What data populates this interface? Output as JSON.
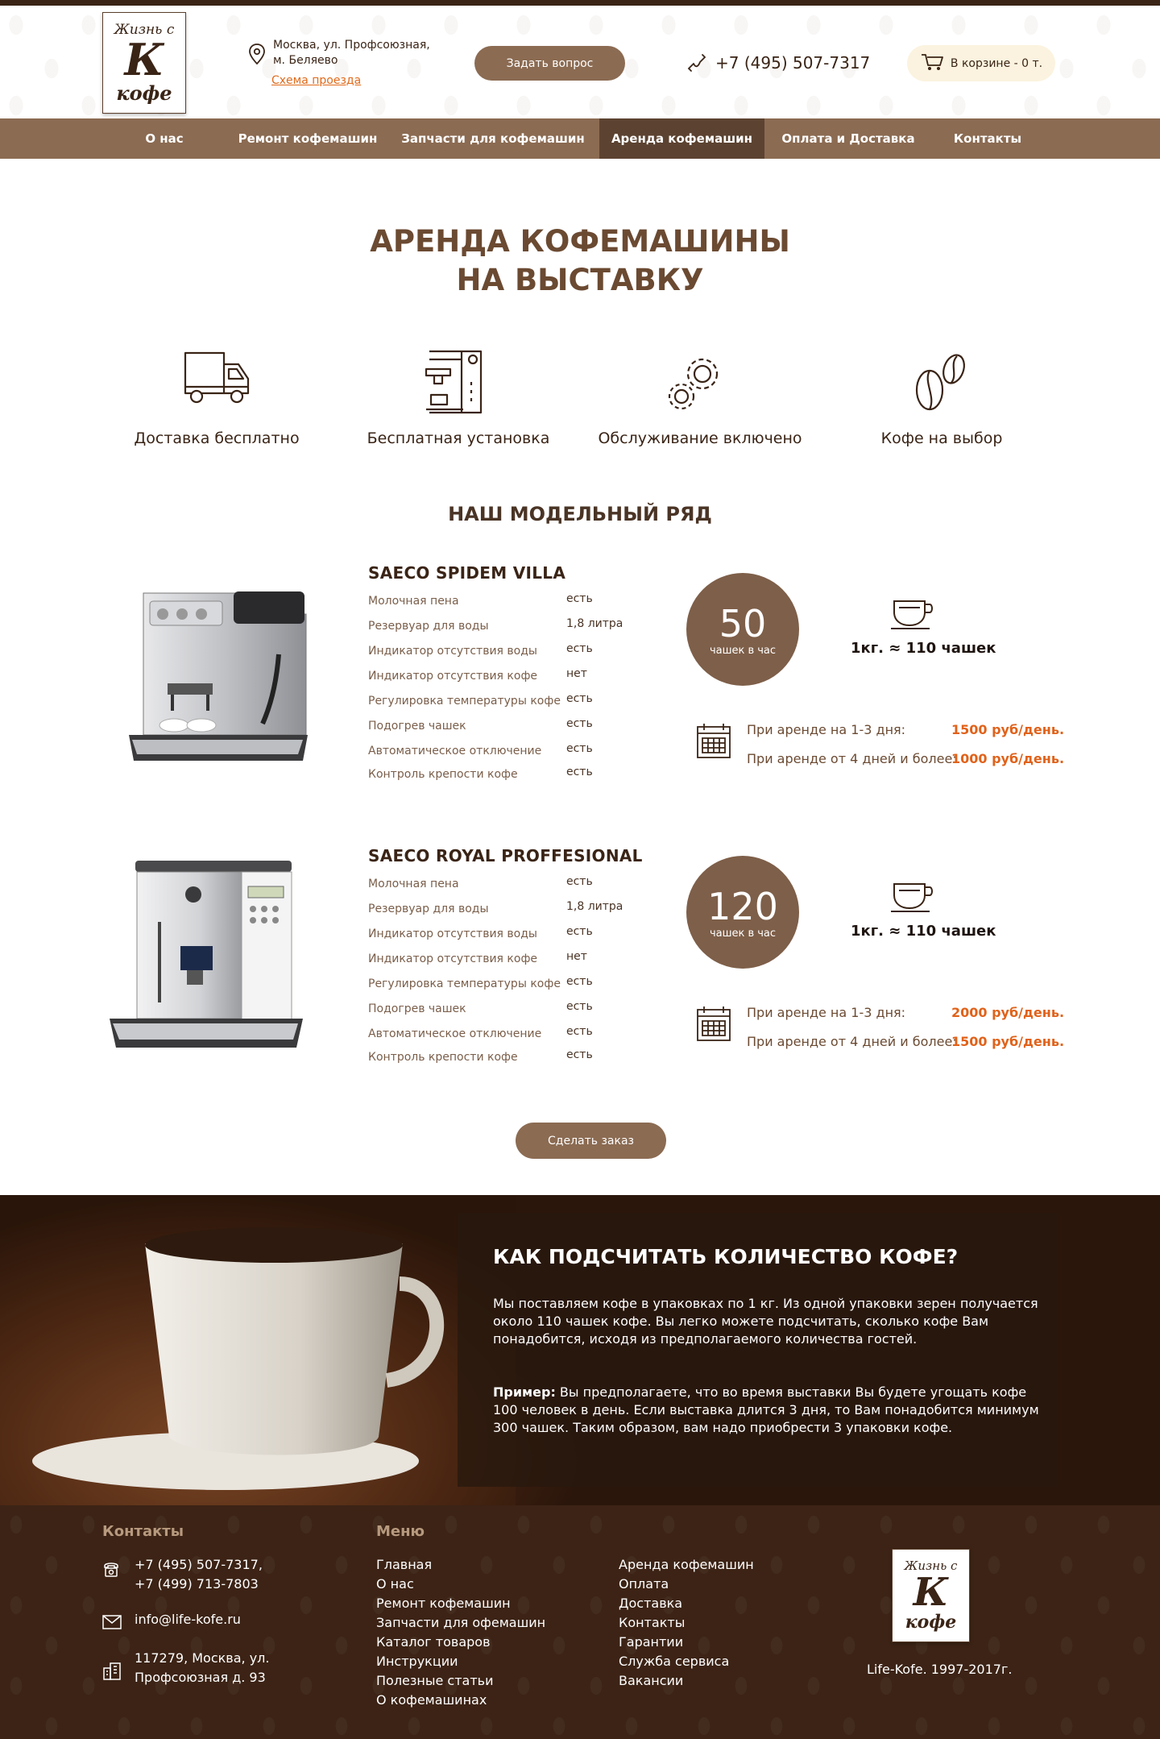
{
  "header": {
    "logo": {
      "line1": "Жизнь с",
      "big": "К",
      "line2": "кофе"
    },
    "address_line1": "Москва, ул. Профсоюзная,",
    "address_line2": "м. Беляево",
    "map_link": "Схема проезда",
    "ask_button": "Задать вопрос",
    "phone": "+7 (495) 507-7317",
    "cart": "В корзине - 0 т."
  },
  "nav": {
    "items": [
      {
        "label": "О нас"
      },
      {
        "label": "Ремонт кофемашин"
      },
      {
        "label": "Запчасти для кофемашин"
      },
      {
        "label": "Аренда кофемашин"
      },
      {
        "label": "Оплата и Доставка"
      },
      {
        "label": "Контакты"
      }
    ],
    "active_index": 3
  },
  "main": {
    "title_line1": "АРЕНДА КОФЕМАШИНЫ",
    "title_line2": "НА ВЫСТАВКУ",
    "features": [
      {
        "label": "Доставка бесплатно",
        "icon": "truck-icon"
      },
      {
        "label": "Бесплатная установка",
        "icon": "coffee-machine-icon"
      },
      {
        "label": "Обслуживание включено",
        "icon": "gears-icon"
      },
      {
        "label": "Кофе на выбор",
        "icon": "coffee-beans-icon"
      }
    ],
    "models_title": "НАШ МОДЕЛЬНЫЙ РЯД",
    "models": [
      {
        "name": "SAECO SPIDEM VILLA",
        "specs": [
          {
            "name": "Молочная пена",
            "value": "есть"
          },
          {
            "name": "Резервуар для воды",
            "value": "1,8 литра"
          },
          {
            "name": "Индикатор отсутствия воды",
            "value": "есть"
          },
          {
            "name": "Индикатор отсутствия кофе",
            "value": "нет"
          },
          {
            "name": "Регулировка температуры кофе",
            "value": "есть"
          },
          {
            "name": "Подогрев чашек",
            "value": "есть"
          },
          {
            "name": "Автоматическое отключение",
            "value": "есть"
          },
          {
            "name": "Контроль крепости кофе",
            "value": "есть"
          }
        ],
        "cups_per_hour": "50",
        "cups_per_hour_label": "чашек в час",
        "yield": "1кг.  ≈ 110 чашек",
        "price1_label": "При аренде на 1-3 дня:",
        "price1": "1500 руб/день.",
        "price2_label": "При аренде от 4 дней и более:",
        "price2": "1000 руб/день."
      },
      {
        "name": "SAECO ROYAL PROFFESIONAL",
        "specs": [
          {
            "name": "Молочная пена",
            "value": "есть"
          },
          {
            "name": "Резервуар для воды",
            "value": "1,8 литра"
          },
          {
            "name": "Индикатор отсутствия воды",
            "value": "есть"
          },
          {
            "name": "Индикатор отсутствия кофе",
            "value": "нет"
          },
          {
            "name": "Регулировка температуры кофе",
            "value": "есть"
          },
          {
            "name": "Подогрев чашек",
            "value": "есть"
          },
          {
            "name": "Автоматическое отключение",
            "value": "есть"
          },
          {
            "name": "Контроль крепости кофе",
            "value": "есть"
          }
        ],
        "cups_per_hour": "120",
        "cups_per_hour_label": "чашек в час",
        "yield": "1кг.  ≈ 110 чашек",
        "price1_label": "При аренде на 1-3 дня:",
        "price1": "2000 руб/день.",
        "price2_label": "При аренде от 4 дней и более:",
        "price2": "1500 руб/день."
      }
    ],
    "order_button": "Сделать заказ"
  },
  "coffee_section": {
    "title": "КАК ПОДСЧИТАТЬ КОЛИЧЕСТВО КОФЕ?",
    "paragraph1": "Мы поставляем кофе в упаковках по 1 кг. Из одной упаковки зерен получается около 110 чашек кофе. Вы легко можете подсчитать, сколько кофе Вам понадобится, исходя из предполагаемого количества гостей.",
    "example_label": "Пример:",
    "example_text": " Вы предполагаете, что во время выставки Вы будете угощать кофе 100 человек в день. Если выставка длится 3 дня, то Вам понадобится минимум 300 чашек. Таким образом, вам надо приобрести 3 упаковки кофе."
  },
  "footer": {
    "contacts_title": "Контакты",
    "phone1": "+7 (495) 507-7317,",
    "phone2": "+7 (499) 713-7803",
    "email": "info@life-kofe.ru",
    "address1": "117279, Москва, ул.",
    "address2": "Профсоюзная д. 93",
    "menu_title": "Меню",
    "menu_col1": [
      "Главная",
      "О нас",
      "Ремонт кофемашин",
      "Запчасти для офемашин",
      "Каталог товаров",
      "Инструкции",
      "Полезные статьи",
      "О кофемашинах"
    ],
    "menu_col2": [
      "Аренда кофемашин",
      "Оплата",
      "Доставка",
      "Контакты",
      "Гарантии",
      "Служба сервиса",
      "Вакансии"
    ],
    "copyright": "Life-Kofe. 1997-2017г."
  },
  "colors": {
    "brand_brown": "#8b6b52",
    "dark_brown": "#3a2416",
    "price_orange": "#e0621a",
    "active_nav": "#5c4331"
  }
}
